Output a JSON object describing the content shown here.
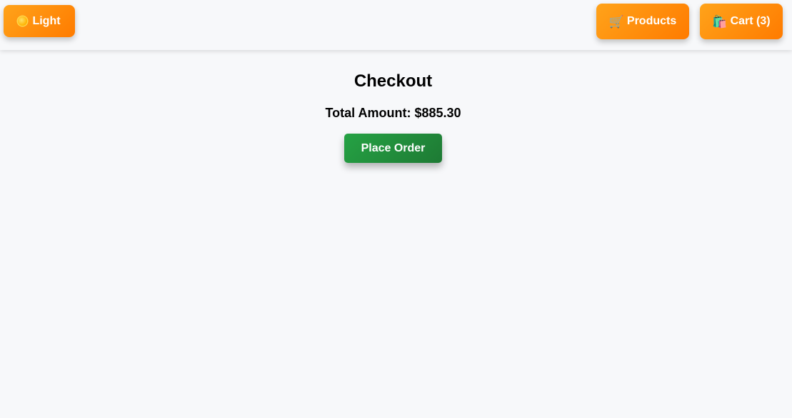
{
  "navbar": {
    "theme_toggle": {
      "icon": "sun-icon",
      "label": "Light"
    },
    "products": {
      "icon": "shopping-cart-icon",
      "icon_glyph": "🛒",
      "label": "Products"
    },
    "cart": {
      "icon": "shopping-bags-icon",
      "icon_glyph": "🛍️",
      "label": "Cart (3)"
    }
  },
  "checkout": {
    "title": "Checkout",
    "total_label": "Total Amount: $885.30",
    "place_order_label": "Place Order"
  },
  "colors": {
    "nav_button_accent": "#ff8c00",
    "place_order_green": "#228b3c",
    "background": "#f7f8fa"
  }
}
